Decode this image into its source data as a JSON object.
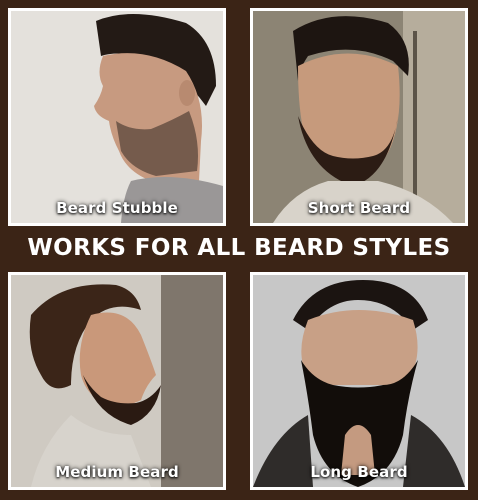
{
  "headline": "WORKS FOR ALL BEARD STYLES",
  "panels": [
    {
      "label": "Beard Stubble"
    },
    {
      "label": "Short Beard"
    },
    {
      "label": "Medium Beard"
    },
    {
      "label": "Long Beard"
    }
  ],
  "colors": {
    "background": "#3b2416",
    "frame": "#ffffff",
    "text": "#ffffff"
  }
}
